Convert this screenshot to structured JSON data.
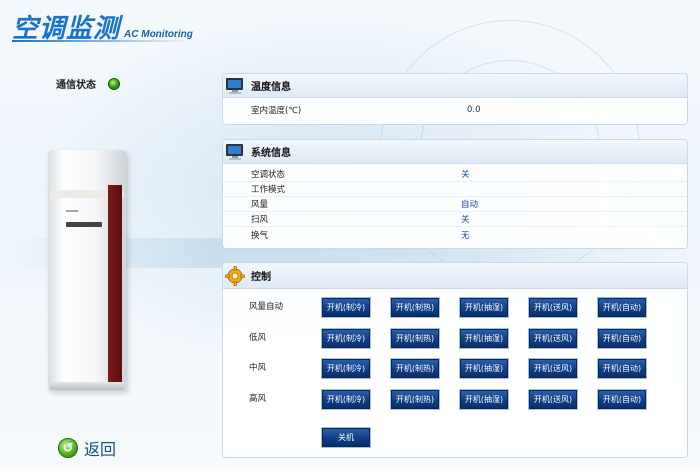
{
  "header": {
    "title_cn": "空调监测",
    "title_en": "AC Monitoring"
  },
  "comm": {
    "label": "通信状态",
    "status_color": "#2c9a1a"
  },
  "back": {
    "label": "返回"
  },
  "temperature": {
    "title": "温度信息",
    "rows": [
      {
        "label": "室内温度(℃)",
        "value": "0.0"
      }
    ]
  },
  "system": {
    "title": "系统信息",
    "rows": [
      {
        "label": "空调状态",
        "value": "关"
      },
      {
        "label": "工作模式",
        "value": ""
      },
      {
        "label": "风量",
        "value": "自动"
      },
      {
        "label": "扫风",
        "value": "关"
      },
      {
        "label": "换气",
        "value": "无"
      }
    ]
  },
  "control": {
    "title": "控制",
    "rows": [
      {
        "label": "风量自动",
        "buttons": [
          "开机(制冷)",
          "开机(制热)",
          "开机(抽湿)",
          "开机(送风)",
          "开机(自动)"
        ]
      },
      {
        "label": "低风",
        "buttons": [
          "开机(制冷)",
          "开机(制热)",
          "开机(抽湿)",
          "开机(送风)",
          "开机(自动)"
        ]
      },
      {
        "label": "中风",
        "buttons": [
          "开机(制冷)",
          "开机(制热)",
          "开机(抽湿)",
          "开机(送风)",
          "开机(自动)"
        ]
      },
      {
        "label": "高风",
        "buttons": [
          "开机(制冷)",
          "开机(制热)",
          "开机(抽湿)",
          "开机(送风)",
          "开机(自动)"
        ]
      }
    ],
    "off_label": "关机"
  },
  "colors": {
    "accent": "#1a73c9",
    "button": "#0f3e86",
    "value": "#1b3fa8"
  },
  "icons": {
    "temperature": "monitor-icon",
    "system": "monitor-icon",
    "control": "gear-icon",
    "back": "back-arrow-icon",
    "comm": "status-dot-icon"
  }
}
